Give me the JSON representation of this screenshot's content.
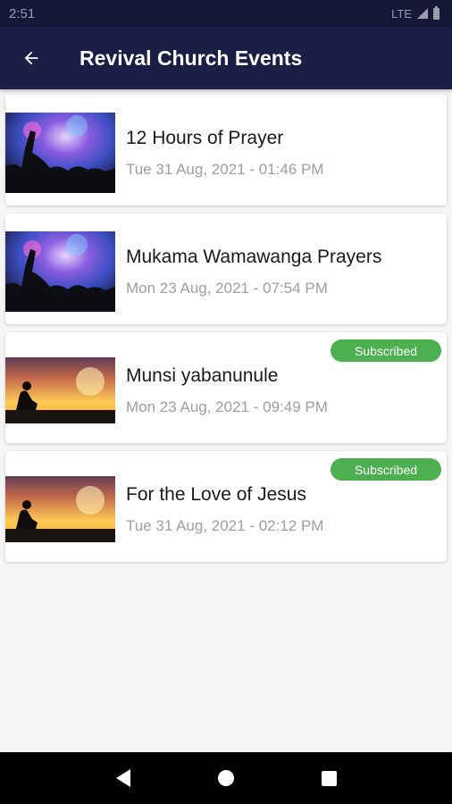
{
  "status_bar": {
    "time": "2:51",
    "network": "LTE"
  },
  "app_bar": {
    "title": "Revival Church Events"
  },
  "events": [
    {
      "title": "12 Hours of Prayer",
      "date": "Tue 31 Aug, 2021 - 01:46 PM",
      "image": "concert-image",
      "badge": ""
    },
    {
      "title": "Mukama Wamawanga Prayers",
      "date": "Mon 23 Aug, 2021 - 07:54 PM",
      "image": "concert-image",
      "badge": ""
    },
    {
      "title": "Munsi yabanunule",
      "date": "Mon 23 Aug, 2021 - 09:49 PM",
      "image": "kneeling-prayer-image",
      "badge": "Subscribed"
    },
    {
      "title": "For the Love of Jesus",
      "date": "Tue 31 Aug, 2021 - 02:12 PM",
      "image": "kneeling-prayer-image",
      "badge": "Subscribed"
    }
  ],
  "colors": {
    "app_bar": "#1b1e45",
    "badge": "#4caf50",
    "background": "#f5f5f5"
  }
}
